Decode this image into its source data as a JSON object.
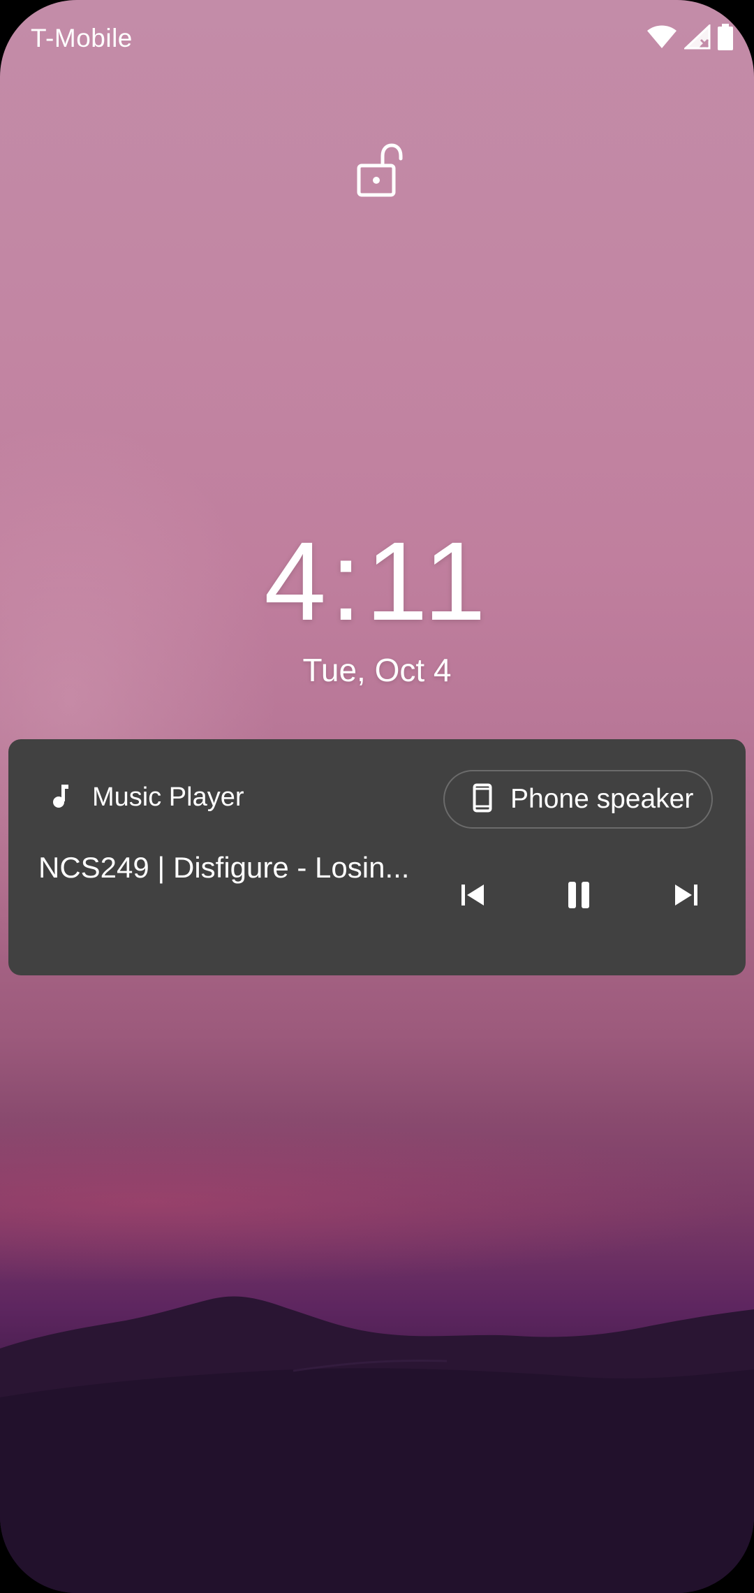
{
  "status_bar": {
    "carrier": "T-Mobile",
    "icons": [
      "wifi-icon",
      "signal-no-service-icon",
      "battery-full-icon"
    ]
  },
  "lock": {
    "icon": "unlocked-padlock-icon"
  },
  "clock": {
    "time": "4:11",
    "date": "Tue, Oct 4"
  },
  "media": {
    "app_icon": "music-note-icon",
    "app_name": "Music Player",
    "output_icon": "phone-icon",
    "output_label": "Phone speaker",
    "track_title": "NCS249 | Disfigure - Losin...",
    "controls": [
      "skip-previous-icon",
      "pause-icon",
      "skip-next-icon"
    ],
    "card_color": "#414141"
  },
  "colors": {
    "text": "#ffffff",
    "wallpaper_top": "#c38ca8",
    "wallpaper_bottom": "#1d0a25"
  }
}
